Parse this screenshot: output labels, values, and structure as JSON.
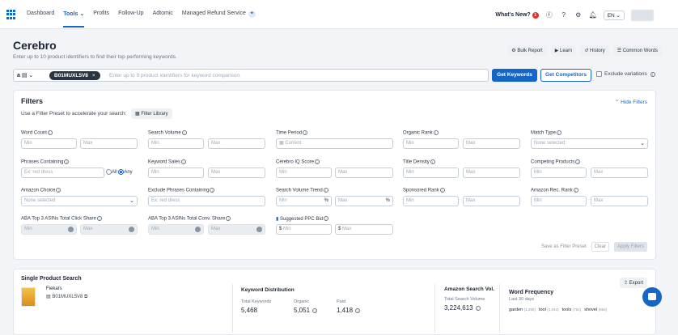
{
  "nav": {
    "items": [
      "Dashboard",
      "Tools",
      "Profits",
      "Follow-Up",
      "Adtomic",
      "Managed Refund Service"
    ],
    "active": "Tools",
    "whats_new": "What's New?",
    "whats_new_count": "1",
    "language": "EN"
  },
  "header": {
    "title": "Cerebro",
    "subtitle": "Enter up to 10 product identifiers to find their top performing keywords.",
    "buttons": [
      "Bulk Report",
      "Learn",
      "History",
      "Common Words"
    ]
  },
  "search": {
    "marketplace": "a",
    "chip": "B01MUXL5V8",
    "placeholder": "Enter up to 9 product identifiers for keyword comparison.",
    "get_keywords": "Get Keywords",
    "get_competitors": "Get Competitors",
    "exclude_variations": "Exclude variations"
  },
  "filters": {
    "title": "Filters",
    "hide": "Hide Filters",
    "preset_text": "Use a Filter Preset to accelerate your search:",
    "library": "Filter Library",
    "labels": {
      "word_count": "Word Count",
      "search_volume": "Search Volume",
      "time_period": "Time Period",
      "organic_rank": "Organic Rank",
      "match_type": "Match Type",
      "phrases_containing": "Phrases Containing",
      "keyword_sales": "Keyword Sales",
      "cerebro_iq": "Cerebro IQ Score",
      "title_density": "Title Density",
      "competing_products": "Competing Products",
      "amazon_choice": "Amazon Choice",
      "exclude_phrases": "Exclude Phrases Containing",
      "sv_trend": "Search Volume Trend",
      "sponsored_rank": "Sponsored Rank",
      "amazon_rec_rank": "Amazon Rec. Rank",
      "aba_click": "ABA Top 3 ASINs Total Click Share",
      "aba_conv": "ABA Top 3 ASINs Total Conv. Share",
      "ppc_bid": "Suggested PPC Bid"
    },
    "ph": {
      "min": "Min",
      "max": "Max",
      "current": "Current",
      "none_selected": "None selected",
      "red_dress": "Ex: red dress",
      "ex_red_dress": "Ex: red dress",
      "all": "All",
      "any": "Any",
      "pct": "%",
      "dollar": "$"
    },
    "save_preset": "Save as Filter Preset",
    "clear": "Clear",
    "apply": "Apply Filters"
  },
  "single": {
    "title": "Single Product Search",
    "export": "Export",
    "brand": "Fiekars",
    "asin": "B01MUXL5V8",
    "kd_title": "Keyword Distribution",
    "kd_total_label": "Total Keywords",
    "kd_total": "5,468",
    "kd_organic_label": "Organic",
    "kd_organic": "5,051",
    "kd_paid_label": "Paid",
    "kd_paid": "1,418",
    "asv_title": "Amazon Search Vol.",
    "asv_label": "Total Search Volume",
    "asv_value": "3,224,613",
    "wf_title": "Word Frequency",
    "wf_sub": "Last 30 days",
    "words": [
      {
        "w": "garden",
        "n": "(1,290)"
      },
      {
        "w": "tool",
        "n": "(1,044)"
      },
      {
        "w": "tools",
        "n": "(761)"
      },
      {
        "w": "shovel",
        "n": "(664)"
      }
    ]
  }
}
